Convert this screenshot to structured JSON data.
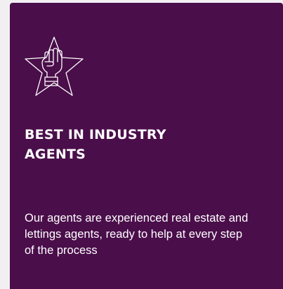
{
  "card": {
    "icon": "fist-star-icon",
    "title_line1": "BEST IN INDUSTRY",
    "title_line2": "AGENTS",
    "description": "Our agents are experienced real estate and lettings agents, ready to help at every step of the process"
  },
  "colors": {
    "card_background": "#4a0e4a",
    "text": "#ffffff",
    "page_background": "#f2eff3"
  }
}
